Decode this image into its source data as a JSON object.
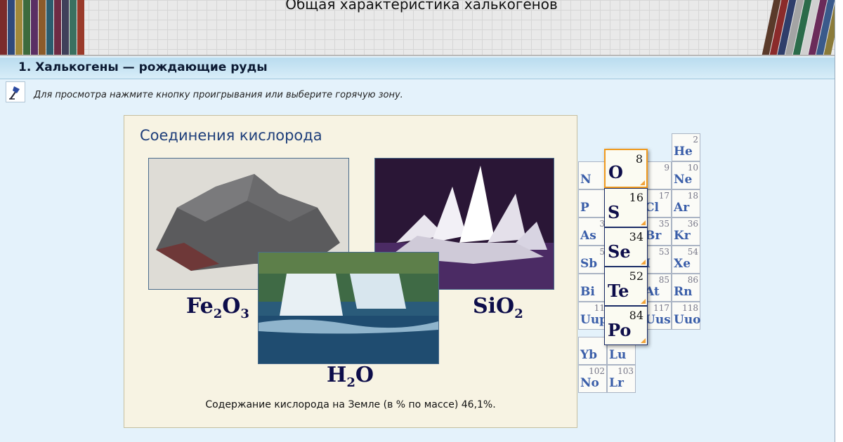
{
  "header": {
    "title": "Общая характеристика халькогенов"
  },
  "section": {
    "title": "1. Халькогены — рождающие руды"
  },
  "hint": {
    "icon": "pushpin-icon",
    "text": "Для просмотра нажмите кнопку проигрывания или выберите горячую зону."
  },
  "panel": {
    "title": "Соединения кислорода",
    "photos": [
      {
        "icon": "hematite-rock-photo"
      },
      {
        "icon": "quartz-crystal-photo"
      },
      {
        "icon": "waterfall-photo"
      }
    ],
    "formulas": {
      "fe2o3": {
        "a": "Fe",
        "b": "2",
        "c": "O",
        "d": "3"
      },
      "sio2": {
        "a": "SiO",
        "b": "2"
      },
      "h2o": {
        "a": "H",
        "b": "2",
        "c": "O"
      }
    },
    "caption": "Содержание кислорода на Земле (в % по массе) 46,1%."
  },
  "table": {
    "left_column": [
      {
        "sym": "N",
        "num": ""
      },
      {
        "sym": "P",
        "num": ""
      },
      {
        "sym": "As",
        "num": "3"
      },
      {
        "sym": "Sb",
        "num": "5"
      },
      {
        "sym": "Bi",
        "num": ""
      },
      {
        "sym": "Uup",
        "num": "11"
      },
      {
        "sym": "Yb",
        "num": ""
      },
      {
        "sym": "No",
        "num": "102"
      }
    ],
    "halogen_column": [
      {
        "sym": "",
        "num": "9"
      },
      {
        "sym": "Cl",
        "num": "17"
      },
      {
        "sym": "Br",
        "num": "35"
      },
      {
        "sym": "I",
        "num": "53"
      },
      {
        "sym": "At",
        "num": "85"
      },
      {
        "sym": "Uus",
        "num": "117"
      }
    ],
    "noble_column": [
      {
        "sym": "He",
        "num": "2"
      },
      {
        "sym": "Ne",
        "num": "10"
      },
      {
        "sym": "Ar",
        "num": "18"
      },
      {
        "sym": "Kr",
        "num": "36"
      },
      {
        "sym": "Xe",
        "num": "54"
      },
      {
        "sym": "Rn",
        "num": "86"
      },
      {
        "sym": "Uuo",
        "num": "118"
      }
    ],
    "lanthanide": [
      {
        "sym": "Lu",
        "num": ""
      },
      {
        "sym": "Lr",
        "num": "103"
      }
    ],
    "chalcogens": [
      {
        "sym": "O",
        "num": "8"
      },
      {
        "sym": "S",
        "num": "16"
      },
      {
        "sym": "Se",
        "num": "34"
      },
      {
        "sym": "Te",
        "num": "52"
      },
      {
        "sym": "Po",
        "num": "84"
      }
    ]
  }
}
